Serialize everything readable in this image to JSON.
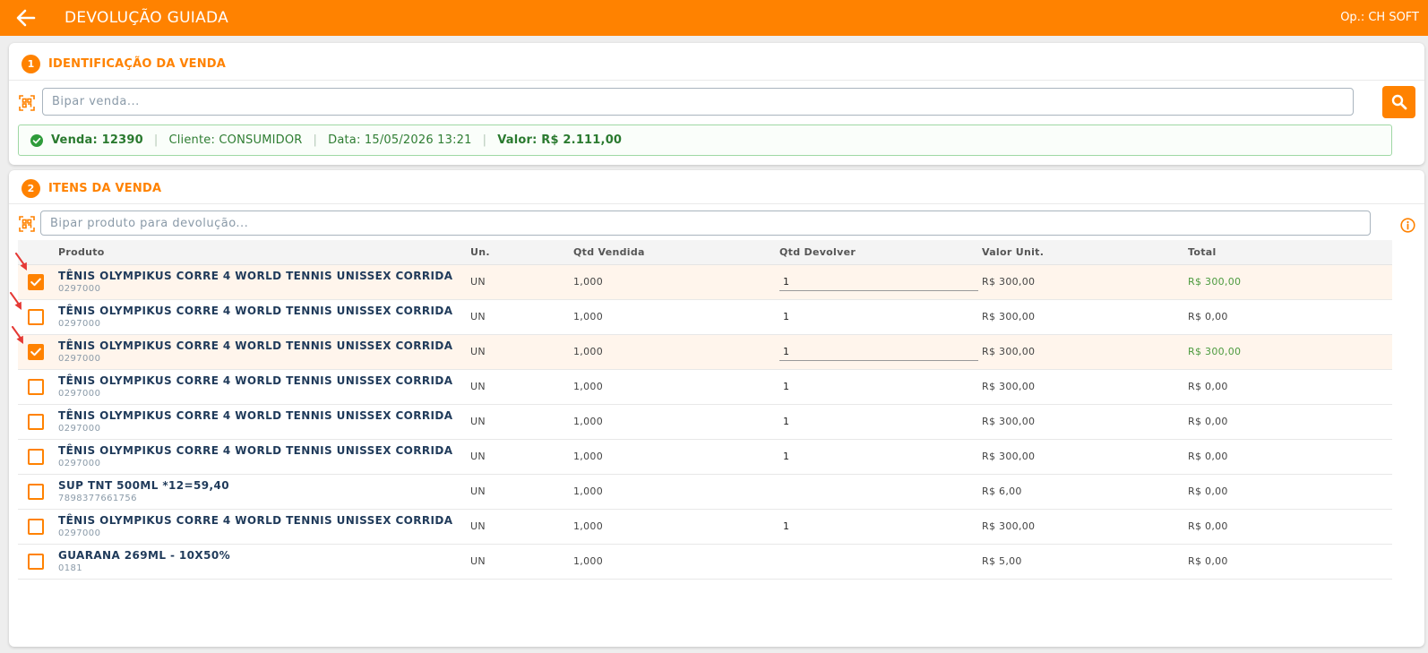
{
  "header": {
    "title": "DEVOLUÇÃO GUIADA",
    "operator": "Op.: CH SOFT"
  },
  "identification": {
    "step": "1",
    "title": "IDENTIFICAÇÃO DA VENDA",
    "input_value": "",
    "input_placeholder": "Bipar venda...",
    "summary": {
      "sale": "Venda: 12390",
      "customer": "Cliente: CONSUMIDOR",
      "date": "Data: 15/05/2026 13:21",
      "value": "Valor: R$ 2.111,00"
    }
  },
  "items_section": {
    "step": "2",
    "title": "ITENS DA VENDA",
    "input_value": "",
    "input_placeholder": "Bipar produto para devolução...",
    "columns": {
      "product": "Produto",
      "unit": "Un.",
      "qty_sold": "Qtd Vendida",
      "qty_return": "Qtd Devolver",
      "unit_value": "Valor Unit.",
      "total": "Total"
    },
    "rows": [
      {
        "selected": true,
        "name": "TÊNIS OLYMPIKUS CORRE 4 WORLD TENNIS UNISSEX CORRIDA",
        "code": "0297000",
        "unit": "UN",
        "qty_sold": "1,000",
        "qty_return": "1",
        "unit_value": "R$ 300,00",
        "total": "R$ 300,00"
      },
      {
        "selected": false,
        "name": "TÊNIS OLYMPIKUS CORRE 4 WORLD TENNIS UNISSEX CORRIDA",
        "code": "0297000",
        "unit": "UN",
        "qty_sold": "1,000",
        "qty_return": "1",
        "unit_value": "R$ 300,00",
        "total": "R$ 0,00"
      },
      {
        "selected": true,
        "name": "TÊNIS OLYMPIKUS CORRE 4 WORLD TENNIS UNISSEX CORRIDA",
        "code": "0297000",
        "unit": "UN",
        "qty_sold": "1,000",
        "qty_return": "1",
        "unit_value": "R$ 300,00",
        "total": "R$ 300,00"
      },
      {
        "selected": false,
        "name": "TÊNIS OLYMPIKUS CORRE 4 WORLD TENNIS UNISSEX CORRIDA",
        "code": "0297000",
        "unit": "UN",
        "qty_sold": "1,000",
        "qty_return": "1",
        "unit_value": "R$ 300,00",
        "total": "R$ 0,00"
      },
      {
        "selected": false,
        "name": "TÊNIS OLYMPIKUS CORRE 4 WORLD TENNIS UNISSEX CORRIDA",
        "code": "0297000",
        "unit": "UN",
        "qty_sold": "1,000",
        "qty_return": "1",
        "unit_value": "R$ 300,00",
        "total": "R$ 0,00"
      },
      {
        "selected": false,
        "name": "TÊNIS OLYMPIKUS CORRE 4 WORLD TENNIS UNISSEX CORRIDA",
        "code": "0297000",
        "unit": "UN",
        "qty_sold": "1,000",
        "qty_return": "1",
        "unit_value": "R$ 300,00",
        "total": "R$ 0,00"
      },
      {
        "selected": false,
        "name": "SUP TNT 500ML *12=59,40",
        "code": "7898377661756",
        "unit": "UN",
        "qty_sold": "1,000",
        "qty_return": "",
        "unit_value": "R$ 6,00",
        "total": "R$ 0,00"
      },
      {
        "selected": false,
        "name": "TÊNIS OLYMPIKUS CORRE 4 WORLD TENNIS UNISSEX CORRIDA",
        "code": "0297000",
        "unit": "UN",
        "qty_sold": "1,000",
        "qty_return": "1",
        "unit_value": "R$ 300,00",
        "total": "R$ 0,00"
      },
      {
        "selected": false,
        "name": "GUARANA 269ML - 10X50%",
        "code": "0181",
        "unit": "UN",
        "qty_sold": "1,000",
        "qty_return": "",
        "unit_value": "R$ 5,00",
        "total": "R$ 0,00"
      }
    ]
  },
  "colors": {
    "accent": "#ff8200",
    "success": "#2e7d32",
    "marker": "#e53935"
  },
  "icons": [
    "arrow-left-icon",
    "qr-scan-icon",
    "search-icon",
    "check-circle-icon",
    "info-icon",
    "checkbox-icon",
    "red-arrow-marker"
  ]
}
